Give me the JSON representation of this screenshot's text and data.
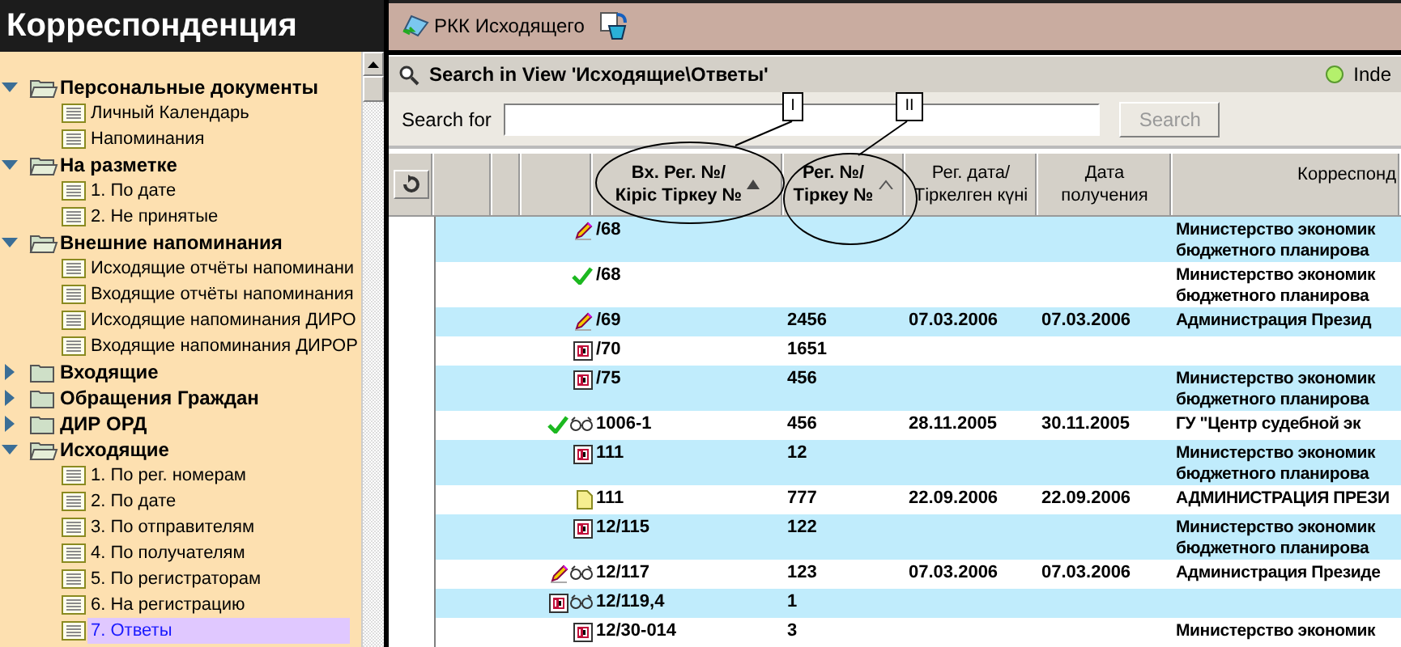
{
  "sidebar": {
    "title": "Корреспонденция",
    "tree": [
      {
        "label": "Персональные документы",
        "expanded": true,
        "children": [
          {
            "label": "Личный Календарь",
            "selected": false
          },
          {
            "label": "Напоминания",
            "selected": false
          }
        ]
      },
      {
        "label": "На разметке",
        "expanded": true,
        "children": [
          {
            "label": "1. По дате",
            "selected": false
          },
          {
            "label": "2. Не принятые",
            "selected": false
          }
        ]
      },
      {
        "label": "Внешние напоминания",
        "expanded": true,
        "children": [
          {
            "label": "Исходящие отчёты напоминани",
            "selected": false
          },
          {
            "label": "Входящие отчёты напоминания",
            "selected": false
          },
          {
            "label": "Исходящие напоминания ДИРО",
            "selected": false
          },
          {
            "label": "Входящие напоминания ДИРОР",
            "selected": false
          }
        ]
      },
      {
        "label": "Входящие",
        "expanded": false
      },
      {
        "label": "Обращения Граждан",
        "expanded": false
      },
      {
        "label": "ДИР ОРД",
        "expanded": false
      },
      {
        "label": "Исходящие",
        "expanded": true,
        "children": [
          {
            "label": "1. По рег. номерам",
            "selected": false
          },
          {
            "label": "2. По дате",
            "selected": false
          },
          {
            "label": "3. По отправителям",
            "selected": false
          },
          {
            "label": "4. По получателям",
            "selected": false
          },
          {
            "label": "5. По регистраторам",
            "selected": false
          },
          {
            "label": "6. На регистрацию",
            "selected": false
          },
          {
            "label": "7. Ответы",
            "selected": true
          }
        ]
      }
    ]
  },
  "toolbar": [
    {
      "kind": "labeled",
      "label": "РКК Исходящего"
    },
    {
      "kind": "icon"
    }
  ],
  "search": {
    "title": "Search in View 'Исходящие\\Ответы'",
    "status": "Inde",
    "label": "Search for",
    "button": "Search",
    "button_disabled": true
  },
  "table": {
    "columns": [
      {
        "label": "Вх. Рег. №/\nКіріс Тіркеу №",
        "kind": "sorted"
      },
      {
        "label": "Рег. №/\nТіркеу №",
        "kind": "sortable"
      },
      {
        "label": "Рег. дата/\nТіркелген күні",
        "kind": "plain"
      },
      {
        "label": "Дата\nполучения",
        "kind": "plain"
      },
      {
        "label": "Корреспонд",
        "kind": "plain"
      }
    ],
    "rows": [
      {
        "icons": [
          {
            "kind": "pencil"
          }
        ],
        "in_no": "/68",
        "correspondent": "Министерство экономик\nбюджетного планирова"
      },
      {
        "icons": [
          {
            "kind": "check"
          }
        ],
        "in_no": "/68",
        "correspondent": "Министерство экономик\nбюджетного планирова"
      },
      {
        "icons": [
          {
            "kind": "pencil"
          }
        ],
        "in_no": "/69",
        "reg_no": "2456",
        "reg_date": "07.03.2006",
        "received": "07.03.2006",
        "correspondent": "Администрация Презид"
      },
      {
        "icons": [
          {
            "kind": "book"
          }
        ],
        "in_no": "/70",
        "reg_no": "1651"
      },
      {
        "icons": [
          {
            "kind": "book"
          }
        ],
        "in_no": "/75",
        "reg_no": "456",
        "correspondent": "Министерство экономик\nбюджетного планирова"
      },
      {
        "icons": [
          {
            "kind": "check"
          },
          {
            "kind": "glasses"
          }
        ],
        "in_no": "1006-1",
        "reg_no": "456",
        "reg_date": "28.11.2005",
        "received": "30.11.2005",
        "correspondent": "ГУ \"Центр судебной эк"
      },
      {
        "icons": [
          {
            "kind": "book"
          }
        ],
        "in_no": "111",
        "reg_no": "12",
        "correspondent": "Министерство экономик\nбюджетного планирова"
      },
      {
        "icons": [
          {
            "kind": "doc"
          }
        ],
        "in_no": "111",
        "reg_no": "777",
        "reg_date": "22.09.2006",
        "received": "22.09.2006",
        "correspondent": "АДМИНИСТРАЦИЯ ПРЕЗИ"
      },
      {
        "icons": [
          {
            "kind": "book"
          }
        ],
        "in_no": "12/115",
        "reg_no": "122",
        "correspondent": "Министерство экономик\nбюджетного планирова"
      },
      {
        "icons": [
          {
            "kind": "pencil"
          },
          {
            "kind": "glasses"
          }
        ],
        "in_no": "12/117",
        "reg_no": "123",
        "reg_date": "07.03.2006",
        "received": "07.03.2006",
        "correspondent": "Администрация Президе"
      },
      {
        "icons": [
          {
            "kind": "book"
          },
          {
            "kind": "glasses"
          }
        ],
        "in_no": "12/119,4",
        "reg_no": "1"
      },
      {
        "icons": [
          {
            "kind": "book"
          }
        ],
        "in_no": "12/30-014",
        "reg_no": "3",
        "correspondent": "Министерство экономик"
      }
    ]
  },
  "annotations": [
    {
      "label": "I"
    },
    {
      "label": "II"
    }
  ]
}
